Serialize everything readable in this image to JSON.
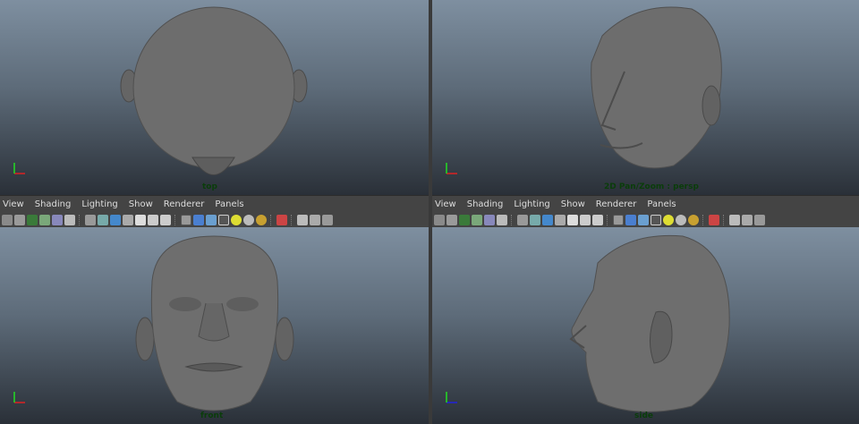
{
  "viewports": {
    "top": {
      "label": "top"
    },
    "persp": {
      "label": "2D Pan/Zoom : persp"
    },
    "front": {
      "label": "front"
    },
    "side": {
      "label": "side"
    }
  },
  "panel_menu": [
    "View",
    "Shading",
    "Lighting",
    "Show",
    "Renderer",
    "Panels"
  ],
  "toolbar_icons": [
    "camera-select-icon",
    "camera-attributes-icon",
    "bookmark-icon",
    "image-plane-icon",
    "2d-pan-zoom-icon",
    "grease-pencil-icon",
    "grid-icon",
    "film-gate-icon",
    "resolution-gate-icon",
    "gate-mask-icon",
    "field-chart-icon",
    "safe-action-icon",
    "safe-title-icon",
    "wireframe-icon",
    "smooth-shade-icon",
    "flat-shade-icon",
    "bounding-box-icon",
    "textured-icon",
    "lights-icon",
    "shadows-icon",
    "isolate-select-icon",
    "xray-icon",
    "xray-joints-icon",
    "ambient-occlusion-icon"
  ],
  "colors": {
    "bg_top": "#7e8fa0",
    "bg_bottom": "#2a3038",
    "head": "#6e6e6e",
    "label": "#0a3d0a"
  }
}
